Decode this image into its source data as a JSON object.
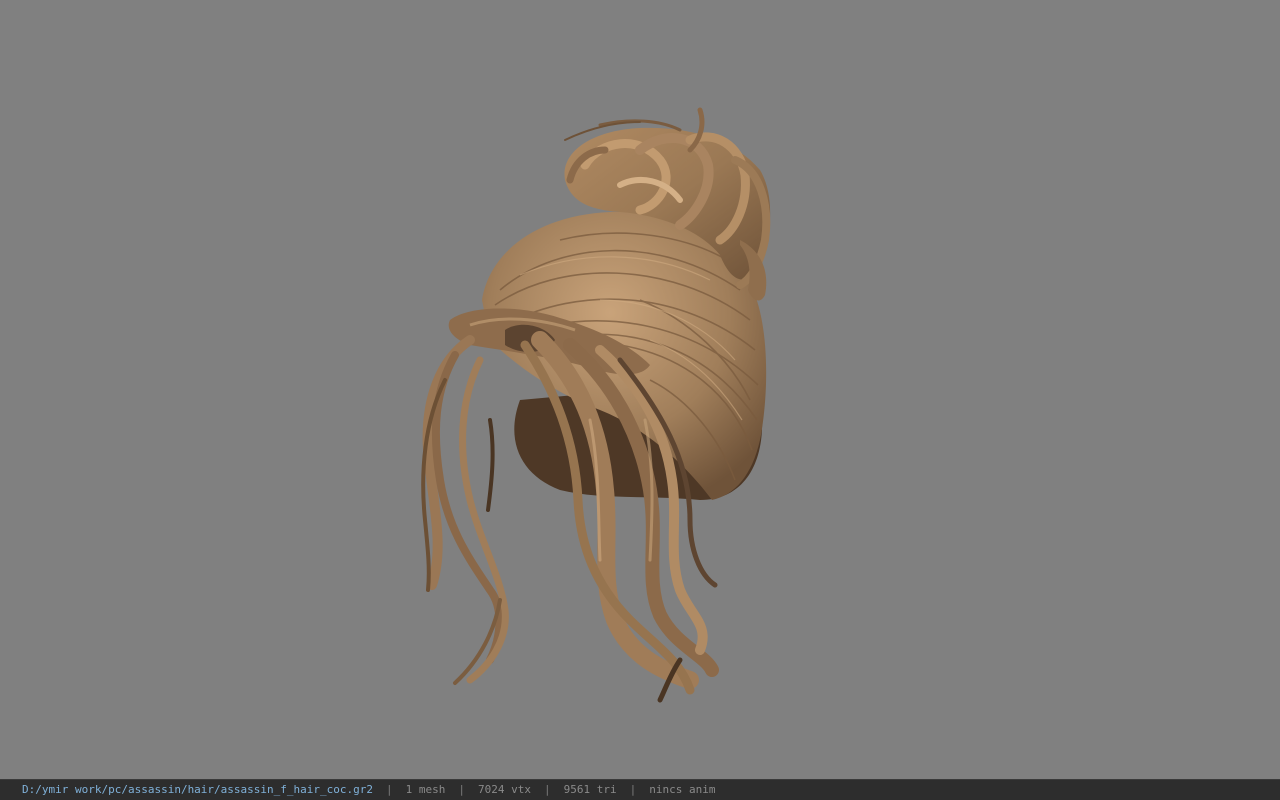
{
  "viewer": {
    "background_color": "#808080",
    "model_icon": "hair-model",
    "hair_colors": {
      "base": "#8a6c4e",
      "light": "#c49e74",
      "mid": "#a27f5b",
      "dark": "#4a3522"
    }
  },
  "statusbar": {
    "file_path": "D:/ymir work/pc/assassin/hair/assassin_f_hair_coc.gr2",
    "separator": "|",
    "mesh": "1 mesh",
    "vertices": "7024 vtx",
    "triangles": "9561 tri",
    "animation": "nincs anim",
    "path_color": "#7fb0d8"
  }
}
